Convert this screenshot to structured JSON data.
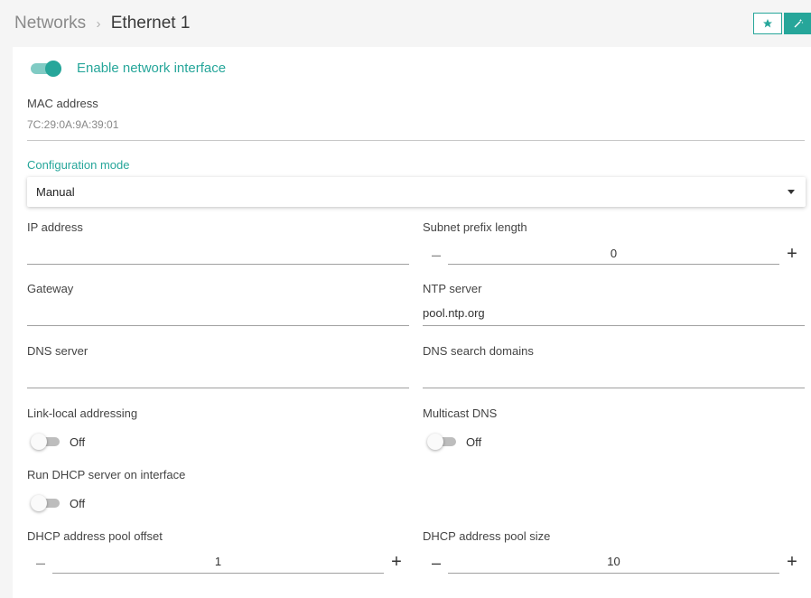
{
  "breadcrumb": {
    "parent": "Networks",
    "separator": "›",
    "current": "Ethernet 1"
  },
  "header": {
    "star_icon": "star-icon",
    "wand_icon": "magic-wand-icon"
  },
  "colors": {
    "accent": "#26a69a",
    "accent_light": "#80cbc4"
  },
  "enable": {
    "label": "Enable network interface",
    "on": true
  },
  "mac": {
    "label": "MAC address",
    "value": "7C:29:0A:9A:39:01"
  },
  "config_mode": {
    "label": "Configuration mode",
    "value": "Manual"
  },
  "ip_address": {
    "label": "IP address",
    "value": ""
  },
  "subnet_prefix": {
    "label": "Subnet prefix length",
    "value": "0",
    "minus": "–",
    "plus": "+"
  },
  "gateway": {
    "label": "Gateway",
    "value": ""
  },
  "ntp_server": {
    "label": "NTP server",
    "value": "pool.ntp.org"
  },
  "dns_server": {
    "label": "DNS server",
    "value": ""
  },
  "dns_search": {
    "label": "DNS search domains",
    "value": ""
  },
  "link_local": {
    "label": "Link-local addressing",
    "state": "Off"
  },
  "multicast_dns": {
    "label": "Multicast DNS",
    "state": "Off"
  },
  "dhcp_server": {
    "label": "Run DHCP server on interface",
    "state": "Off"
  },
  "pool_offset": {
    "label": "DHCP address pool offset",
    "value": "1",
    "minus": "–",
    "plus": "+"
  },
  "pool_size": {
    "label": "DHCP address pool size",
    "value": "10",
    "minus": "–",
    "plus": "+"
  }
}
